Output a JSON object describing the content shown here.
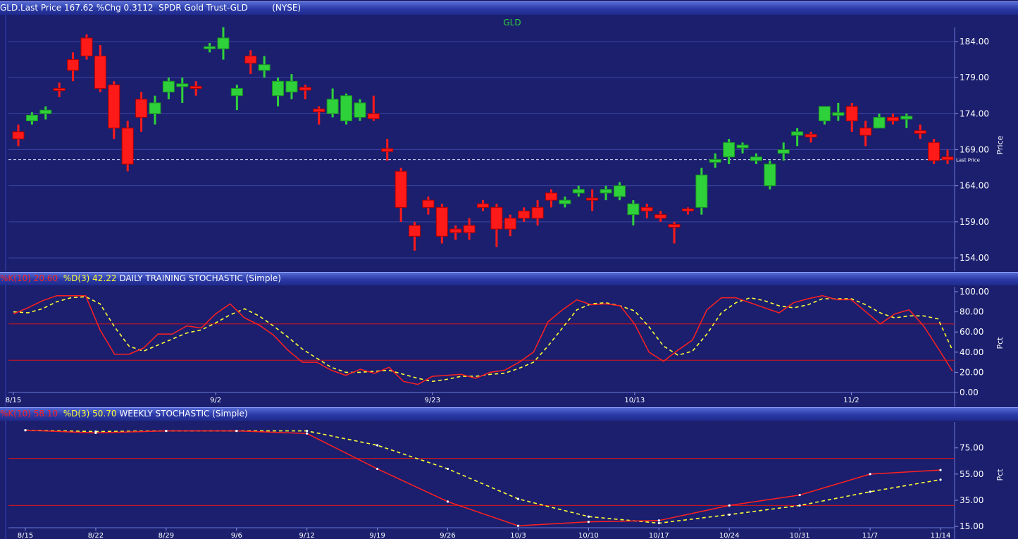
{
  "header": {
    "symbol_line": "GLD.Last Price 167.62 %Chg 0.3112  SPDR Gold Trust-GLD",
    "exchange": "(NYSE)"
  },
  "colors": {
    "up": "#2fd13a",
    "down": "#ff1a1a",
    "k_line": "#ff2020",
    "d_line": "#ffff33",
    "panel_bg": "#1b1f6e"
  },
  "chart_data": [
    {
      "type": "candlestick",
      "title": "GLD",
      "ylabel": "Price",
      "ylim": [
        154,
        186
      ],
      "yticks": [
        "184.00",
        "179.00",
        "174.00",
        "169.00",
        "164.00",
        "159.00",
        "154.00"
      ],
      "last_price_label": "Last Price",
      "last_price": 167.62,
      "candles": [
        [
          171.5,
          170.5,
          172.5,
          169.5
        ],
        [
          173.0,
          173.8,
          174.2,
          172.5
        ],
        [
          174.0,
          174.5,
          175.0,
          173.2
        ],
        [
          177.5,
          177.2,
          178.3,
          176.3
        ],
        [
          181.5,
          180.0,
          182.5,
          178.5
        ],
        [
          184.5,
          182.0,
          185.0,
          181.5
        ],
        [
          182.0,
          177.5,
          183.5,
          177.0
        ],
        [
          178.0,
          172.0,
          178.5,
          170.5
        ],
        [
          172.0,
          167.0,
          173.0,
          166.0
        ],
        [
          176.0,
          173.5,
          177.0,
          171.5
        ],
        [
          174.0,
          175.5,
          176.5,
          172.5
        ],
        [
          177.0,
          178.5,
          179.0,
          176.0
        ],
        [
          178.0,
          178.0,
          179.0,
          175.5
        ],
        [
          177.8,
          177.5,
          178.5,
          176.5
        ],
        [
          183.0,
          183.3,
          183.8,
          182.5
        ],
        [
          183.0,
          184.5,
          186.0,
          181.5
        ],
        [
          176.5,
          177.5,
          178.0,
          174.5
        ],
        [
          182.0,
          181.0,
          182.8,
          179.5
        ],
        [
          180.0,
          180.8,
          182.0,
          179.0
        ],
        [
          176.5,
          178.5,
          179.0,
          175.0
        ],
        [
          177.0,
          178.5,
          179.5,
          176.0
        ],
        [
          177.5,
          177.3,
          178.0,
          176.0
        ],
        [
          174.5,
          174.3,
          175.0,
          172.5
        ],
        [
          174.0,
          176.0,
          177.5,
          173.5
        ],
        [
          173.0,
          176.5,
          176.8,
          172.5
        ],
        [
          173.5,
          175.5,
          176.0,
          173.0
        ],
        [
          174.0,
          173.3,
          176.5,
          173.0
        ],
        [
          169.0,
          169.0,
          170.5,
          167.5
        ],
        [
          166.0,
          161.0,
          166.5,
          159.0
        ],
        [
          157.0,
          158.5,
          159.0,
          155.0
        ],
        [
          162.0,
          161.0,
          162.5,
          160.0
        ],
        [
          161.0,
          157.0,
          161.5,
          156.0
        ],
        [
          157.5,
          158.0,
          158.5,
          156.5
        ],
        [
          158.5,
          157.5,
          159.5,
          156.5
        ],
        [
          161.5,
          161.0,
          162.0,
          160.5
        ],
        [
          161.0,
          158.0,
          161.5,
          155.5
        ],
        [
          159.5,
          158.0,
          160.0,
          157.0
        ],
        [
          160.5,
          159.5,
          161.0,
          159.0
        ],
        [
          161.0,
          159.5,
          162.0,
          158.5
        ],
        [
          163.0,
          162.0,
          163.5,
          161.0
        ],
        [
          161.5,
          162.0,
          162.5,
          161.0
        ],
        [
          163.0,
          163.5,
          164.0,
          162.5
        ],
        [
          162.0,
          162.3,
          163.5,
          160.5
        ],
        [
          163.0,
          163.5,
          164.0,
          162.0
        ],
        [
          162.5,
          164.0,
          164.5,
          162.0
        ],
        [
          160.0,
          161.5,
          162.0,
          158.5
        ],
        [
          160.5,
          161.0,
          161.5,
          159.5
        ],
        [
          159.5,
          160.0,
          160.5,
          159.0
        ],
        [
          158.5,
          158.3,
          159.0,
          156.0
        ],
        [
          160.8,
          160.5,
          161.0,
          160.0
        ],
        [
          161.0,
          165.5,
          166.5,
          160.0
        ],
        [
          167.5,
          167.5,
          168.5,
          166.5
        ],
        [
          168.0,
          170.0,
          170.5,
          167.0
        ],
        [
          169.5,
          169.5,
          170.0,
          168.5
        ],
        [
          167.5,
          168.0,
          168.5,
          167.0
        ],
        [
          164.0,
          167.0,
          167.5,
          163.5
        ],
        [
          168.5,
          169.0,
          170.0,
          167.5
        ],
        [
          171.0,
          171.5,
          172.0,
          169.5
        ],
        [
          171.0,
          170.8,
          171.5,
          170.0
        ],
        [
          173.0,
          175.0,
          175.0,
          172.5
        ],
        [
          174.0,
          174.0,
          175.5,
          173.0
        ],
        [
          175.0,
          173.0,
          175.5,
          171.5
        ],
        [
          172.0,
          171.0,
          173.0,
          169.5
        ],
        [
          172.0,
          173.5,
          174.0,
          172.0
        ],
        [
          173.5,
          173.0,
          174.0,
          172.5
        ],
        [
          173.5,
          173.5,
          174.0,
          172.0
        ],
        [
          171.5,
          171.3,
          172.5,
          170.5
        ],
        [
          170.0,
          167.5,
          170.5,
          167.0
        ],
        [
          168.0,
          167.6,
          169.0,
          167.0
        ]
      ]
    },
    {
      "type": "line",
      "title": "DAILY TRAINING STOCHASTIC (Simple)",
      "k_label": "%K(10) 20.60",
      "d_label": "%D(3) 42.22",
      "ylabel": "Pct",
      "ylim": [
        0,
        100
      ],
      "yticks": [
        "100.00",
        "80.00",
        "60.00",
        "40.00",
        "20.00",
        "0.00"
      ],
      "bands": [
        68,
        32
      ],
      "x_labels": [
        "8/15",
        "9/2",
        "9/23",
        "10/13",
        "11/2"
      ],
      "x_label_index": [
        0,
        14,
        29,
        43,
        58
      ],
      "k_values": [
        78,
        84,
        91,
        96,
        96,
        96,
        62,
        38,
        38,
        44,
        58,
        58,
        66,
        64,
        78,
        88,
        74,
        67,
        57,
        42,
        30,
        30,
        22,
        17,
        23,
        19,
        25,
        11,
        8,
        16,
        17,
        18,
        14,
        20,
        22,
        30,
        40,
        70,
        82,
        92,
        87,
        88,
        86,
        68,
        40,
        31,
        42,
        52,
        82,
        94,
        94,
        89,
        84,
        79,
        89,
        93,
        96,
        92,
        92,
        80,
        68,
        78,
        82,
        66,
        44,
        21
      ],
      "d_values": [
        80,
        79,
        83,
        90,
        94,
        95,
        88,
        65,
        46,
        41,
        47,
        53,
        59,
        62,
        69,
        77,
        83,
        76,
        66,
        55,
        43,
        34,
        25,
        20,
        20,
        21,
        22,
        18,
        14,
        11,
        13,
        16,
        16,
        18,
        19,
        24,
        30,
        46,
        64,
        82,
        88,
        89,
        86,
        81,
        65,
        46,
        37,
        41,
        58,
        79,
        89,
        94,
        91,
        86,
        84,
        87,
        93,
        93,
        93,
        87,
        79,
        74,
        76,
        76,
        73,
        42
      ]
    },
    {
      "type": "line",
      "title": "WEEKLY STOCHASTIC (Simple)",
      "k_label": "%K(10) 58.10",
      "d_label": "%D(3) 50.70",
      "ylabel": "Pct",
      "ylim": [
        14,
        91
      ],
      "yticks": [
        "75.00",
        "55.00",
        "35.00",
        "15.00"
      ],
      "bands": [
        67,
        31
      ],
      "x_labels": [
        "8/15",
        "8/22",
        "8/29",
        "9/6",
        "9/12",
        "9/19",
        "9/26",
        "10/3",
        "10/10",
        "10/17",
        "10/24",
        "10/31",
        "11/7",
        "11/14"
      ],
      "k_values": [
        88.5,
        86.5,
        88.0,
        88.0,
        86.0,
        59.0,
        34.0,
        15.5,
        18.5,
        19.5,
        31.0,
        39.0,
        55.0,
        58.1
      ],
      "d_values": [
        88.5,
        87.5,
        88.0,
        88.0,
        88.0,
        77.0,
        59.0,
        36.0,
        22.5,
        17.5,
        24.0,
        31.0,
        41.5,
        50.7
      ]
    }
  ]
}
